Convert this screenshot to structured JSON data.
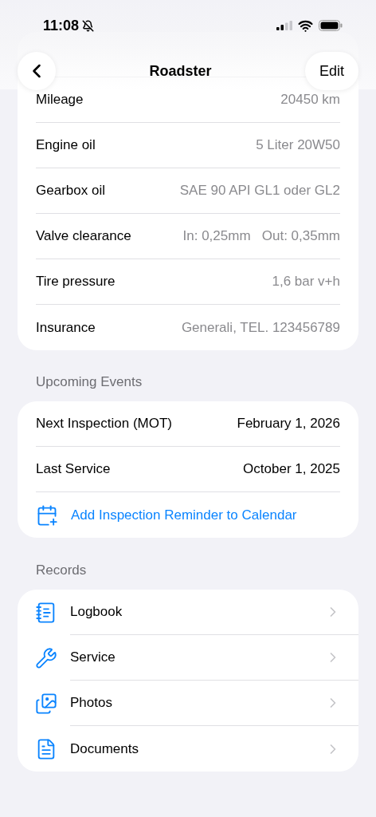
{
  "status_bar": {
    "time": "11:08"
  },
  "nav": {
    "title": "Roadster",
    "edit": "Edit"
  },
  "key_information": {
    "rows": [
      {
        "label": "Mileage",
        "value": "20450 km"
      },
      {
        "label": "Engine oil",
        "value": "5 Liter 20W50"
      },
      {
        "label": "Gearbox oil",
        "value": "SAE 90 API GL1 oder GL2"
      },
      {
        "label": "Valve clearance",
        "value": "In: 0,25mm   Out: 0,35mm"
      },
      {
        "label": "Tire pressure",
        "value": "1,6 bar v+h"
      },
      {
        "label": "Insurance",
        "value": "Generali, TEL. 123456789"
      }
    ]
  },
  "upcoming_events": {
    "heading": "Upcoming Events",
    "rows": [
      {
        "label": "Next Inspection (MOT)",
        "value": "February 1, 2026"
      },
      {
        "label": "Last Service",
        "value": "October 1, 2025"
      }
    ],
    "action": "Add Inspection Reminder to Calendar"
  },
  "records": {
    "heading": "Records",
    "items": [
      {
        "label": "Logbook"
      },
      {
        "label": "Service"
      },
      {
        "label": "Photos"
      },
      {
        "label": "Documents"
      }
    ]
  }
}
